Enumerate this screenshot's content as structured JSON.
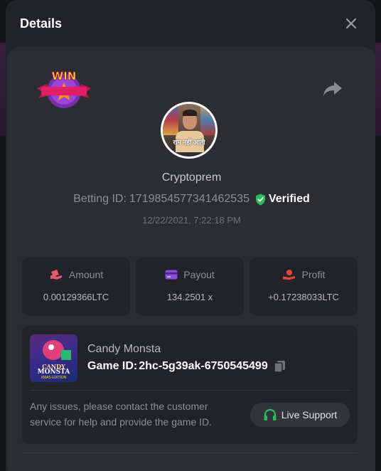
{
  "modal": {
    "title": "Details",
    "close_icon": "close-icon"
  },
  "bet": {
    "badge_text": "WIN",
    "avatar_caption": "राम नहीं आती",
    "username": "Cryptoprem",
    "betting_id_label": "Betting ID:",
    "betting_id": "1719854577341462535",
    "verified_label": "Verified",
    "timestamp": "12/22/2021, 7:22:18 PM"
  },
  "stats": [
    {
      "label": "Amount",
      "value": "0.00129366LTC",
      "icon": "amount-icon",
      "color": "#e85a6a"
    },
    {
      "label": "Payout",
      "value": "134.2501 x",
      "icon": "payout-card-icon",
      "color": "#8a4be0"
    },
    {
      "label": "Profit",
      "value": "+0.17238033LTC",
      "icon": "profit-icon",
      "color": "#e8453c"
    }
  ],
  "game": {
    "name": "Candy Monsta",
    "thumb_line1": "CANDY",
    "thumb_line2": "MONSTA",
    "thumb_line3": "XMAS EDITION",
    "game_id_label": "Game ID:",
    "game_id": "2hc-5g39ak-6750545499",
    "support_text": "Any issues, please contact the customer service for help and provide the game ID.",
    "support_button": "Live Support"
  },
  "colors": {
    "verified": "#2bbd5b",
    "support_icon": "#2bbd5b",
    "modal_bg": "#222328",
    "card_bg": "#2b2d33"
  }
}
